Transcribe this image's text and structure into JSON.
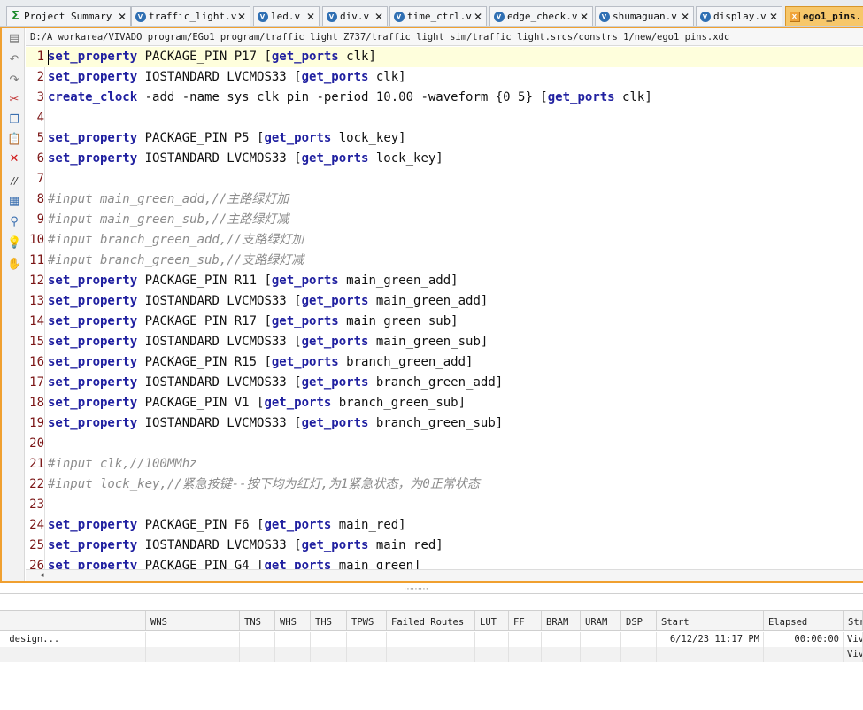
{
  "tabs": [
    {
      "label": "Project Summary",
      "icon": "sigma-icon",
      "active": false
    },
    {
      "label": "traffic_light.v",
      "icon": "verilog-file-icon",
      "active": false
    },
    {
      "label": "led.v",
      "icon": "verilog-file-icon",
      "active": false
    },
    {
      "label": "div.v",
      "icon": "verilog-file-icon",
      "active": false
    },
    {
      "label": "time_ctrl.v",
      "icon": "verilog-file-icon",
      "active": false
    },
    {
      "label": "edge_check.v",
      "icon": "verilog-file-icon",
      "active": false
    },
    {
      "label": "shumaguan.v",
      "icon": "verilog-file-icon",
      "active": false
    },
    {
      "label": "display.v",
      "icon": "verilog-file-icon",
      "active": false
    },
    {
      "label": "ego1_pins.",
      "icon": "constraints-file-icon",
      "active": true
    }
  ],
  "tab_close_glyph": "✕",
  "file_path": "D:/A_workarea/VIVADO_program/EGo1_program/traffic_light_Z737/traffic_light_sim/traffic_light.srcs/constrs_1/new/ego1_pins.xdc",
  "toolbar_icons": [
    "save-icon",
    "undo-icon",
    "redo-icon",
    "cut-icon",
    "copy-icon",
    "paste-icon",
    "delete-icon",
    "comment-toggle-icon",
    "select-all-icon",
    "find-replace-icon",
    "lightbulb-icon",
    "quick-help-icon"
  ],
  "code_lines": [
    {
      "n": "1",
      "kw": "set_property",
      "rest": " PACKAGE_PIN P17 [",
      "kw2": "get_ports",
      "tail": " clk]",
      "comment": ""
    },
    {
      "n": "2",
      "kw": "set_property",
      "rest": " IOSTANDARD LVCMOS33 [",
      "kw2": "get_ports",
      "tail": " clk]",
      "comment": ""
    },
    {
      "n": "3",
      "kw": "create_clock",
      "rest": " -add -name sys_clk_pin -period 10.00 -waveform {0 5} [",
      "kw2": "get_ports",
      "tail": " clk]",
      "comment": ""
    },
    {
      "n": "4",
      "kw": "",
      "rest": "",
      "kw2": "",
      "tail": "",
      "comment": ""
    },
    {
      "n": "5",
      "kw": "set_property",
      "rest": " PACKAGE_PIN P5 [",
      "kw2": "get_ports",
      "tail": " lock_key]",
      "comment": ""
    },
    {
      "n": "6",
      "kw": "set_property",
      "rest": " IOSTANDARD LVCMOS33 [",
      "kw2": "get_ports",
      "tail": " lock_key]",
      "comment": ""
    },
    {
      "n": "7",
      "kw": "",
      "rest": "",
      "kw2": "",
      "tail": "",
      "comment": ""
    },
    {
      "n": "8",
      "kw": "",
      "rest": "",
      "kw2": "",
      "tail": "",
      "comment": "#input main_green_add,//主路绿灯加"
    },
    {
      "n": "9",
      "kw": "",
      "rest": "",
      "kw2": "",
      "tail": "",
      "comment": "#input main_green_sub,//主路绿灯减"
    },
    {
      "n": "10",
      "kw": "",
      "rest": "",
      "kw2": "",
      "tail": "",
      "comment": "#input branch_green_add,//支路绿灯加"
    },
    {
      "n": "11",
      "kw": "",
      "rest": "",
      "kw2": "",
      "tail": "",
      "comment": "#input branch_green_sub,//支路绿灯减"
    },
    {
      "n": "12",
      "kw": "set_property",
      "rest": " PACKAGE_PIN R11 [",
      "kw2": "get_ports",
      "tail": " main_green_add]",
      "comment": ""
    },
    {
      "n": "13",
      "kw": "set_property",
      "rest": " IOSTANDARD LVCMOS33 [",
      "kw2": "get_ports",
      "tail": " main_green_add]",
      "comment": ""
    },
    {
      "n": "14",
      "kw": "set_property",
      "rest": " PACKAGE_PIN R17 [",
      "kw2": "get_ports",
      "tail": " main_green_sub]",
      "comment": ""
    },
    {
      "n": "15",
      "kw": "set_property",
      "rest": " IOSTANDARD LVCMOS33 [",
      "kw2": "get_ports",
      "tail": " main_green_sub]",
      "comment": ""
    },
    {
      "n": "16",
      "kw": "set_property",
      "rest": " PACKAGE_PIN R15 [",
      "kw2": "get_ports",
      "tail": " branch_green_add]",
      "comment": ""
    },
    {
      "n": "17",
      "kw": "set_property",
      "rest": " IOSTANDARD LVCMOS33 [",
      "kw2": "get_ports",
      "tail": " branch_green_add]",
      "comment": ""
    },
    {
      "n": "18",
      "kw": "set_property",
      "rest": " PACKAGE_PIN V1 [",
      "kw2": "get_ports",
      "tail": " branch_green_sub]",
      "comment": ""
    },
    {
      "n": "19",
      "kw": "set_property",
      "rest": " IOSTANDARD LVCMOS33 [",
      "kw2": "get_ports",
      "tail": " branch_green_sub]",
      "comment": ""
    },
    {
      "n": "20",
      "kw": "",
      "rest": "",
      "kw2": "",
      "tail": "",
      "comment": ""
    },
    {
      "n": "21",
      "kw": "",
      "rest": "",
      "kw2": "",
      "tail": "",
      "comment": "#input clk,//100MMhz"
    },
    {
      "n": "22",
      "kw": "",
      "rest": "",
      "kw2": "",
      "tail": "",
      "comment": "#input lock_key,//紧急按键--按下均为红灯,为1紧急状态，为0正常状态"
    },
    {
      "n": "23",
      "kw": "",
      "rest": "",
      "kw2": "",
      "tail": "",
      "comment": ""
    },
    {
      "n": "24",
      "kw": "set_property",
      "rest": " PACKAGE_PIN F6 [",
      "kw2": "get_ports",
      "tail": " main_red]",
      "comment": ""
    },
    {
      "n": "25",
      "kw": "set_property",
      "rest": " IOSTANDARD LVCMOS33 [",
      "kw2": "get_ports",
      "tail": " main_red]",
      "comment": ""
    },
    {
      "n": "26",
      "kw": "set_property",
      "rest": " PACKAGE_PIN G4 [",
      "kw2": "get_ports",
      "tail": " main_green]",
      "comment": ""
    }
  ],
  "scroll_arrow": "◂",
  "splitter_grip": "⋯⋯⋯",
  "results": {
    "columns": [
      "",
      "WNS",
      "TNS",
      "WHS",
      "THS",
      "TPWS",
      "Failed Routes",
      "LUT",
      "FF",
      "BRAM",
      "URAM",
      "DSP",
      "Start",
      "Elapsed",
      "Str"
    ],
    "rows": [
      [
        "_design...",
        "",
        "",
        "",
        "",
        "",
        "",
        "",
        "",
        "",
        "",
        "",
        "6/12/23 11:17 PM",
        "00:00:00",
        "Viv"
      ],
      [
        "",
        "",
        "",
        "",
        "",
        "",
        "",
        "",
        "",
        "",
        "",
        "",
        "",
        "",
        "Viv"
      ]
    ]
  },
  "colors": {
    "keyword": "#2020a0",
    "comment": "#8c8c8c",
    "line_number": "#7a1414",
    "active_tab": "#f7c76a",
    "editor_border": "#f0a030"
  }
}
